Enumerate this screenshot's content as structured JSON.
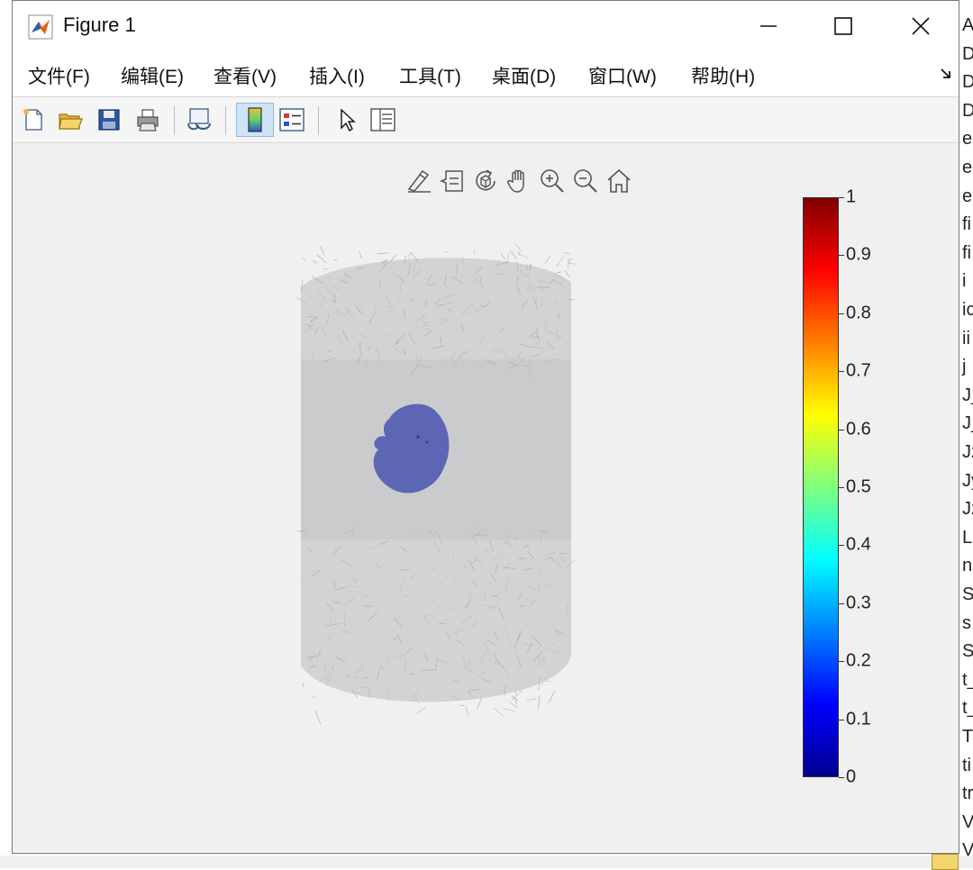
{
  "window": {
    "title": "Figure 1",
    "controls": {
      "minimize": "—",
      "maximize": "☐",
      "close": "✕"
    }
  },
  "menubar": {
    "items": [
      {
        "label": "文件(F)"
      },
      {
        "label": "编辑(E)"
      },
      {
        "label": "查看(V)"
      },
      {
        "label": "插入(I)"
      },
      {
        "label": "工具(T)"
      },
      {
        "label": "桌面(D)"
      },
      {
        "label": "窗口(W)"
      },
      {
        "label": "帮助(H)"
      }
    ],
    "overflow_icon": "menu-overflow-arrow-icon"
  },
  "toolbar": {
    "icons": [
      "new-figure-icon",
      "open-folder-icon",
      "save-icon",
      "print-icon",
      "link-plot-icon",
      "colorbar-icon",
      "legend-icon",
      "pointer-icon",
      "property-inspector-icon"
    ]
  },
  "axes_toolbar": {
    "icons": [
      "brush-icon",
      "data-tips-icon",
      "rotate-3d-icon",
      "pan-hand-icon",
      "zoom-in-icon",
      "zoom-out-icon",
      "home-icon"
    ]
  },
  "colorbar": {
    "colormap": "jet",
    "range": [
      0,
      1
    ],
    "tick_labels": [
      "1",
      "0.9",
      "0.8",
      "0.7",
      "0.6",
      "0.5",
      "0.4",
      "0.3",
      "0.2",
      "0.1",
      "0"
    ],
    "tick_values": [
      1,
      0.9,
      0.8,
      0.7,
      0.6,
      0.5,
      0.4,
      0.3,
      0.2,
      0.1,
      0
    ]
  },
  "plot": {
    "description_colors": {
      "mesh": "#c9cacc",
      "region": "#5560b3"
    },
    "region_value": 0.12
  },
  "side_list": {
    "items": [
      "A",
      "D",
      "D",
      "D",
      "e",
      "e",
      "e",
      "fi",
      "fi",
      "i",
      "ic",
      "ii",
      "j",
      "J_",
      "J_",
      "Jz",
      "Jy",
      "Jz",
      "L",
      "n",
      "S",
      "s",
      "S",
      "t_",
      "t_",
      "T",
      "ti",
      "tr",
      "V",
      "V"
    ]
  }
}
